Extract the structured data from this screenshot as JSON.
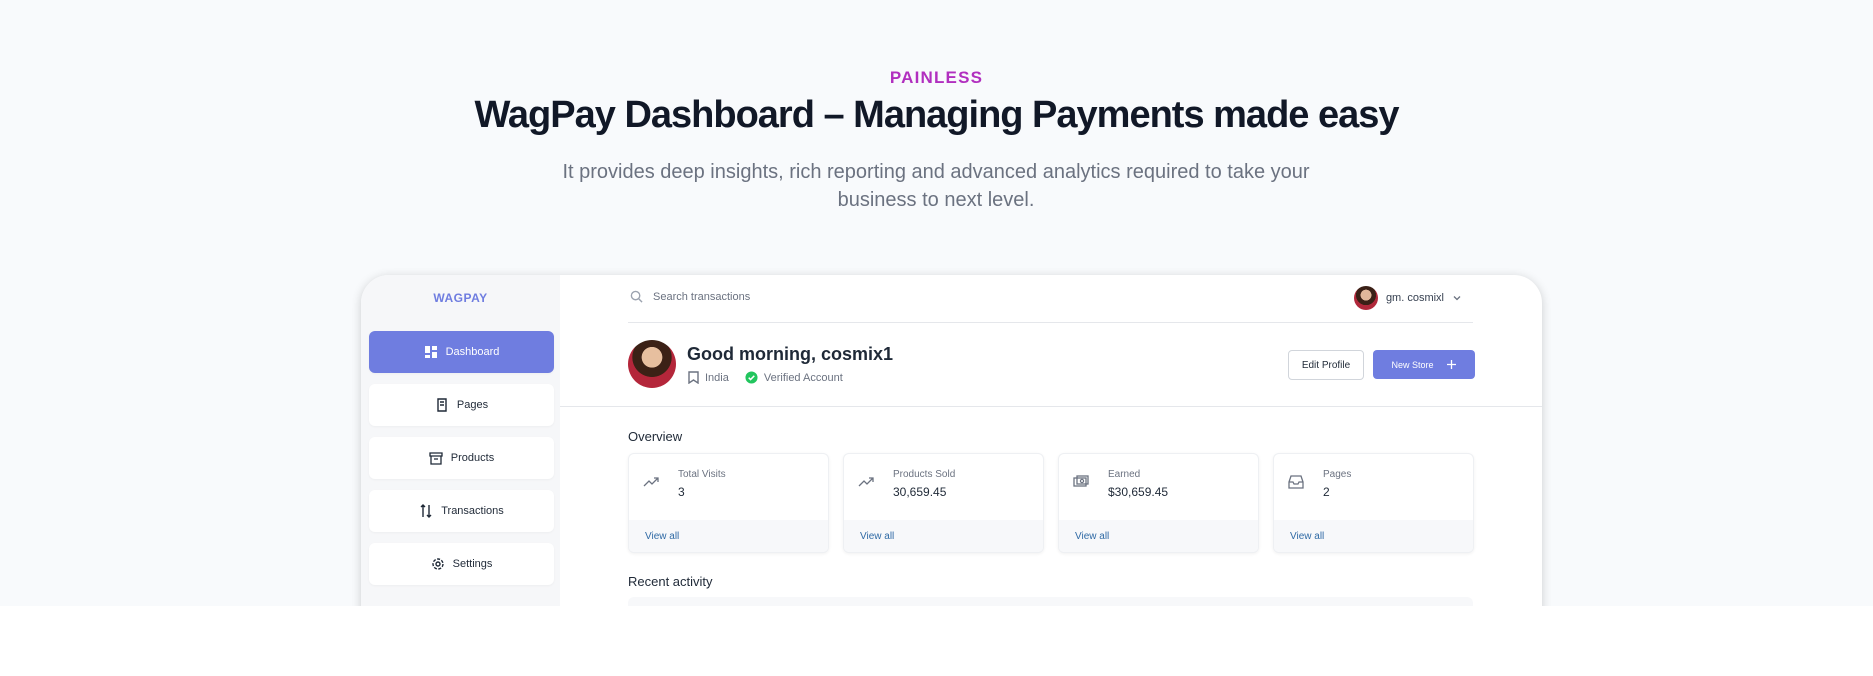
{
  "hero": {
    "eyebrow": "PAINLESS",
    "headline": "WagPay Dashboard – Managing Payments made easy",
    "subtitle": "It provides deep insights, rich reporting and advanced analytics required to take your business to next level."
  },
  "app": {
    "brand": "WAGPAY",
    "accent_color": "#6f7de0",
    "sidebar": {
      "items": [
        {
          "label": "Dashboard",
          "icon": "dashboard-icon",
          "active": true
        },
        {
          "label": "Pages",
          "icon": "pages-icon",
          "active": false
        },
        {
          "label": "Products",
          "icon": "archive-icon",
          "active": false
        },
        {
          "label": "Transactions",
          "icon": "transactions-icon",
          "active": false
        },
        {
          "label": "Settings",
          "icon": "gear-icon",
          "active": false
        }
      ]
    },
    "topbar": {
      "search_placeholder": "Search transactions",
      "username": "gm. cosmixl"
    },
    "profile": {
      "greeting": "Good morning, cosmix1",
      "location": "India",
      "verified": "Verified Account",
      "edit_label": "Edit Profile",
      "new_store_label": "New Store"
    },
    "overview": {
      "title": "Overview",
      "cards": [
        {
          "label": "Total Visits",
          "value": "3",
          "link": "View all",
          "icon": "trend-up-icon"
        },
        {
          "label": "Products Sold",
          "value": "30,659.45",
          "link": "View all",
          "icon": "trend-up-icon"
        },
        {
          "label": "Earned",
          "value": "$30,659.45",
          "link": "View all",
          "icon": "cash-icon"
        },
        {
          "label": "Pages",
          "value": "2",
          "link": "View all",
          "icon": "inbox-icon"
        }
      ]
    },
    "recent_activity": {
      "title": "Recent activity"
    }
  }
}
